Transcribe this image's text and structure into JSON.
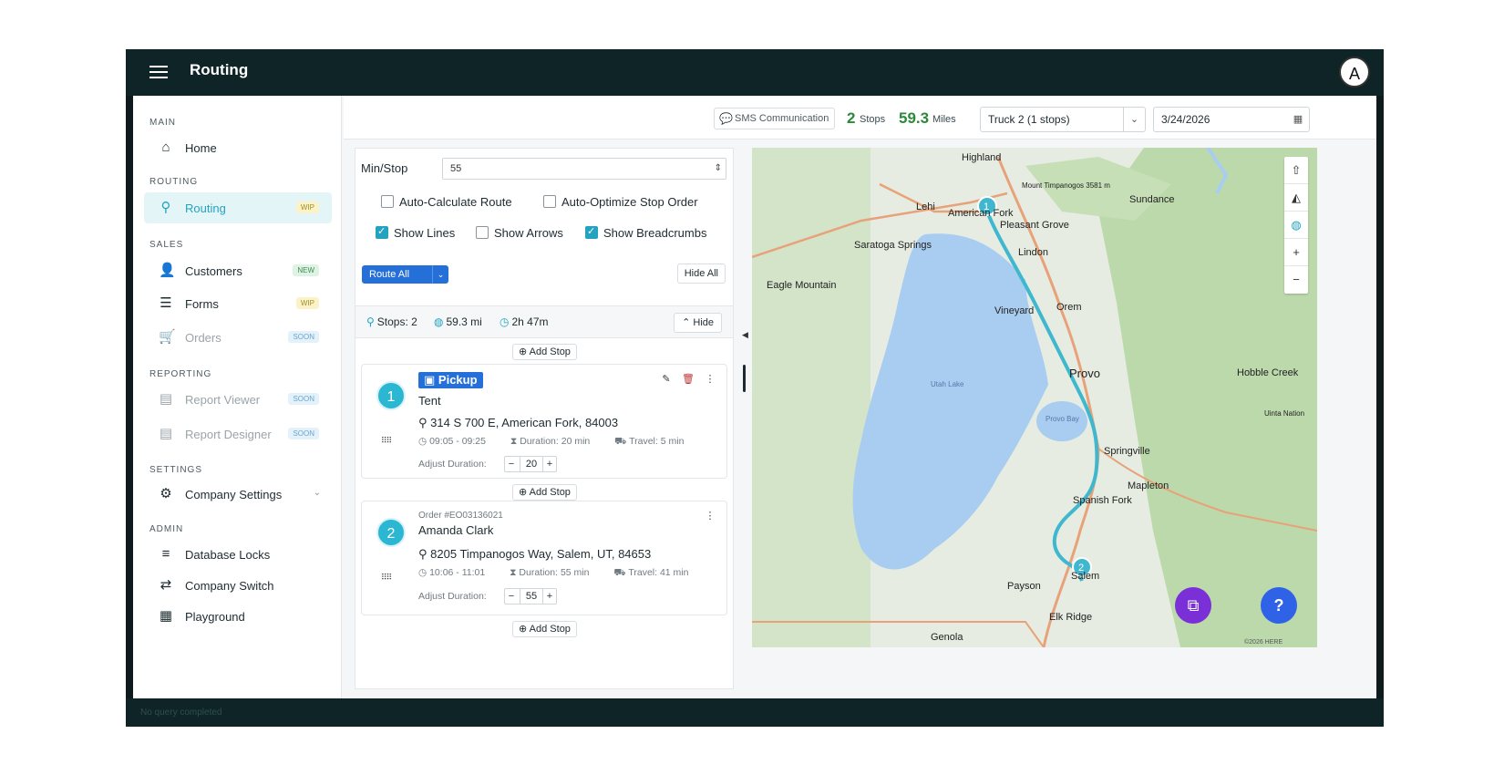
{
  "app": {
    "title": "Routing",
    "avatar": "A",
    "status_text": "No query completed"
  },
  "sidebar": {
    "sections": {
      "main": "MAIN",
      "routing": "ROUTING",
      "sales": "SALES",
      "reporting": "REPORTING",
      "settings": "SETTINGS",
      "admin": "ADMIN"
    },
    "items": [
      {
        "label": "Home",
        "icon": "home-icon"
      },
      {
        "label": "Routing",
        "icon": "map-pin-icon",
        "badge": "WIP"
      },
      {
        "label": "Customers",
        "icon": "person-icon",
        "badge": "NEW"
      },
      {
        "label": "Forms",
        "icon": "list-icon",
        "badge": "WIP"
      },
      {
        "label": "Orders",
        "icon": "cart-icon",
        "badge": "SOON"
      },
      {
        "label": "Report Viewer",
        "icon": "report-icon",
        "badge": "SOON"
      },
      {
        "label": "Report Designer",
        "icon": "report-icon",
        "badge": "SOON"
      },
      {
        "label": "Company Settings",
        "icon": "gear-icon"
      },
      {
        "label": "Database Locks",
        "icon": "database-icon"
      },
      {
        "label": "Company Switch",
        "icon": "switch-icon"
      },
      {
        "label": "Playground",
        "icon": "grid-icon"
      }
    ]
  },
  "toolbar": {
    "sms": "SMS Communication",
    "stops_count": "2",
    "stops_unit": "Stops",
    "miles": "59.3",
    "miles_unit": "Miles",
    "truck": "Truck 2 (1 stops)",
    "date": "3/24/2026"
  },
  "panel": {
    "min_stop_label": "Min/Stop",
    "min_stop_value": "55",
    "auto_calc": "Auto-Calculate Route",
    "auto_opt": "Auto-Optimize Stop Order",
    "show_lines": "Show Lines",
    "show_arrows": "Show Arrows",
    "show_breadcrumbs": "Show Breadcrumbs",
    "route_all": "Route All",
    "hide_all": "Hide All",
    "summary_stops": "Stops: 2",
    "summary_miles": "59.3 mi",
    "summary_time": "2h 47m",
    "hide": "Hide",
    "add_stop": "Add Stop",
    "adjust_label": "Adjust Duration:"
  },
  "stops": [
    {
      "number": "1",
      "tag": "Pickup",
      "name": "Tent",
      "address": "314 S 700 E, American Fork, 84003",
      "time": "09:05 - 09:25",
      "duration": "Duration: 20 min",
      "travel": "Travel: 5 min",
      "adjust": "20"
    },
    {
      "number": "2",
      "order": "Order #EO03136021",
      "name": "Amanda Clark",
      "address": "8205 Timpanogos Way, Salem, UT, 84653",
      "time": "10:06 - 11:01",
      "duration": "Duration: 55 min",
      "travel": "Travel: 41 min",
      "adjust": "55"
    }
  ],
  "map": {
    "labels": [
      "Highland",
      "Lehi",
      "American Fork",
      "Pleasant Grove",
      "Lindon",
      "Saratoga Springs",
      "Eagle Mountain",
      "Vineyard",
      "Orem",
      "Provo",
      "Utah Lake",
      "Provo Bay",
      "Springville",
      "Mapleton",
      "Spanish Fork",
      "Payson",
      "Salem",
      "Elk Ridge",
      "Genola",
      "Sundance",
      "Hobble Creek",
      "Uinta Nation",
      "Mount Timpanogos 3581 m"
    ],
    "copyright": "©2026 HERE"
  }
}
